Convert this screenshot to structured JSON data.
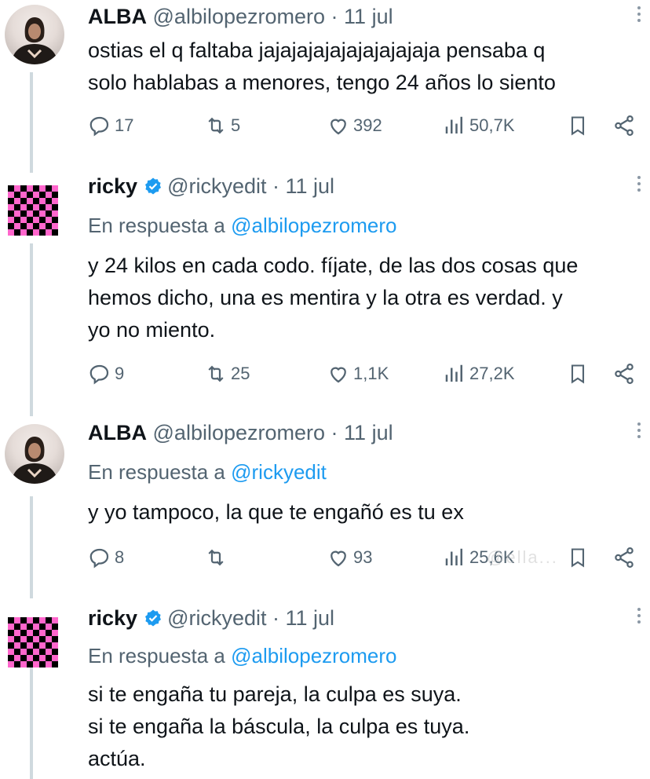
{
  "tweets": [
    {
      "name": "ALBA",
      "handle": "@albilopezromero",
      "date": "· 11 jul",
      "verified": false,
      "replying_label": "",
      "replying_to": "",
      "lines": [
        "ostias el q faltaba jajajajajajajajajajaja pensaba q",
        "solo hablabas a menores, tengo 24 años lo siento"
      ],
      "replies": "17",
      "retweets": "5",
      "likes": "392",
      "views": "50,7K"
    },
    {
      "name": "ricky",
      "handle": "@rickyedit",
      "date": "· 11 jul",
      "verified": true,
      "replying_label": "En respuesta a",
      "replying_to": "@albilopezromero",
      "lines": [
        "y 24 kilos en cada codo. fíjate, de las dos cosas que",
        "hemos dicho, una es mentira y la otra es verdad. y",
        "yo no miento."
      ],
      "replies": "9",
      "retweets": "25",
      "likes": "1,1K",
      "views": "27,2K"
    },
    {
      "name": "ALBA",
      "handle": "@albilopezromero",
      "date": "· 11 jul",
      "verified": false,
      "replying_label": "En respuesta a",
      "replying_to": "@rickyedit",
      "lines": [
        "y yo tampoco, la que te engañó es tu ex"
      ],
      "replies": "8",
      "retweets": "",
      "likes": "93",
      "views": "25,6K"
    },
    {
      "name": "ricky",
      "handle": "@rickyedit",
      "date": "· 11 jul",
      "verified": true,
      "replying_label": "En respuesta a",
      "replying_to": "@albilopezromero",
      "lines": [
        "si te engaña tu pareja, la culpa es suya.",
        "si te engaña la báscula, la culpa es tuya.",
        "actúa."
      ]
    }
  ],
  "watermark": "@ella...",
  "colors": {
    "link": "#1d9bf0",
    "secondary": "#536471",
    "verified": "#1d9bf0",
    "checker_pink": "#ff66cc"
  }
}
